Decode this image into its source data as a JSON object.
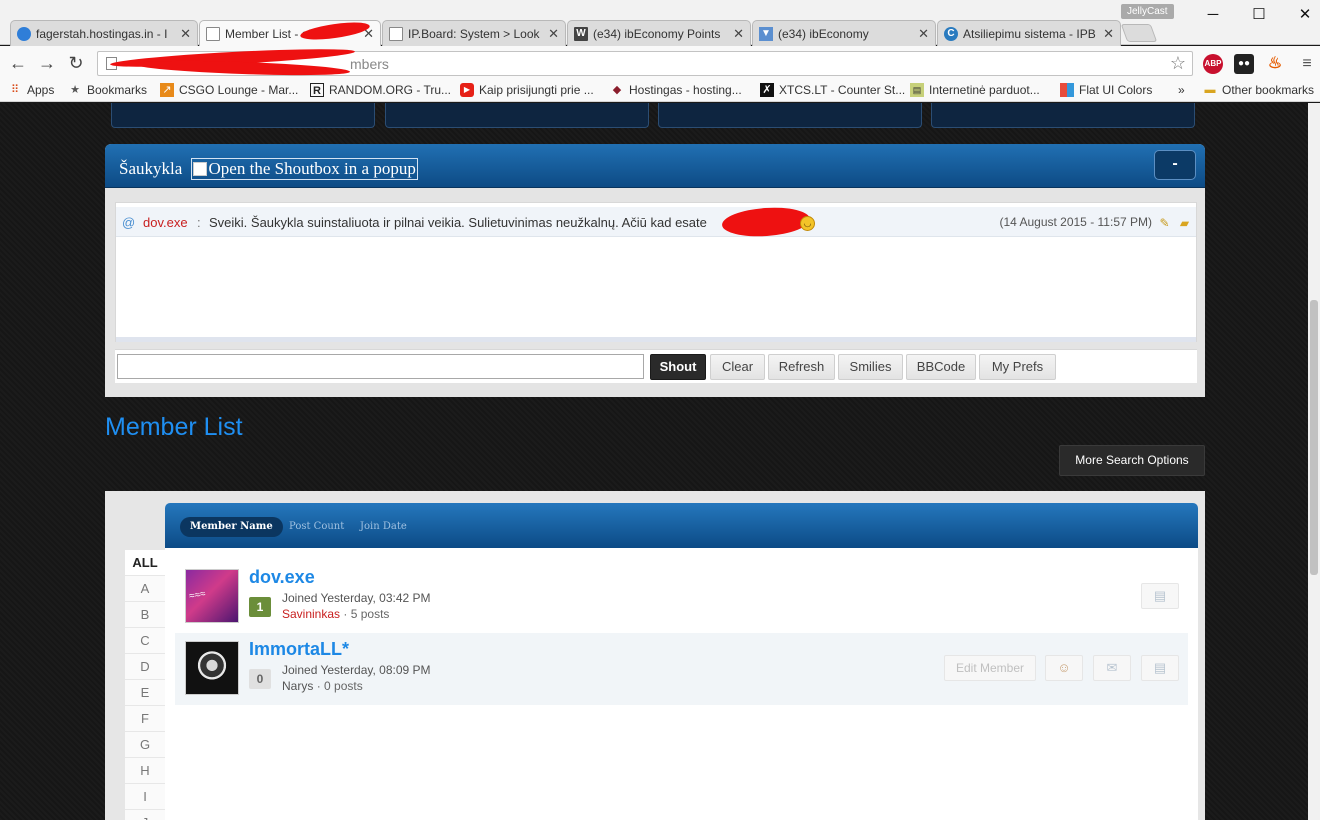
{
  "browser": {
    "profile_label": "JellyCast",
    "tabs": [
      {
        "title": "fagerstah.hostingas.in - I",
        "favicon": "globe-icon",
        "color": "#2f7ed8"
      },
      {
        "title": "Member List - eP",
        "favicon": "page-icon",
        "color": "#ffffff"
      },
      {
        "title": "IP.Board: System > Look",
        "favicon": "page-icon",
        "color": "#ffffff"
      },
      {
        "title": "(e34) ibEconomy Points",
        "favicon": "w-icon",
        "color": "#444444"
      },
      {
        "title": "(e34) ibEconomy",
        "favicon": "v-icon",
        "color": "#5b8fd0"
      },
      {
        "title": "Atsiliepimu sistema - IPB",
        "favicon": "c-icon",
        "color": "#2a7bbf"
      }
    ],
    "address_visible": "mbers",
    "bookmarks": [
      {
        "label": "Apps",
        "icon": "apps-icon"
      },
      {
        "label": "Bookmarks",
        "icon": "star-icon"
      },
      {
        "label": "CSGO Lounge - Mar...",
        "icon": "csgo-icon"
      },
      {
        "label": "RANDOM.ORG - Tru...",
        "icon": "random-icon"
      },
      {
        "label": "Kaip prisijungti prie ...",
        "icon": "youtube-icon"
      },
      {
        "label": "Hostingas - hosting...",
        "icon": "hostingas-icon"
      },
      {
        "label": "XTCS.LT - Counter St...",
        "icon": "xtcs-icon"
      },
      {
        "label": "Internetinė parduot...",
        "icon": "shop-icon"
      },
      {
        "label": "Flat UI Colors",
        "icon": "flatui-icon"
      }
    ],
    "bookmarks_overflow": "»",
    "other_bookmarks": "Other bookmarks",
    "extensions": [
      "ABP",
      "ghost",
      "fire"
    ]
  },
  "shoutbox": {
    "title": "Šaukykla",
    "popup_label": "Open the Shoutbox in a popup",
    "toggle_label": "-",
    "messages": [
      {
        "user": "dov.exe",
        "separator": ":",
        "text": "Sveiki. Šaukykla suinstaliuota ir pilnai veikia. Sulietuvinimas neužkalnų. Ačiū kad esate",
        "time": "(14 August 2015 - 11:57 PM)"
      }
    ],
    "buttons": {
      "shout": "Shout",
      "clear": "Clear",
      "refresh": "Refresh",
      "smilies": "Smilies",
      "bbcode": "BBCode",
      "prefs": "My Prefs"
    }
  },
  "member_list": {
    "title": "Member List",
    "more_search": "More Search Options",
    "sort_tabs": [
      "Member Name",
      "Post Count",
      "Join Date"
    ],
    "letters": [
      "ALL",
      "A",
      "B",
      "C",
      "D",
      "E",
      "F",
      "G",
      "H",
      "I",
      "J"
    ],
    "members": [
      {
        "name": "dov.exe",
        "reputation": "1",
        "rep_color": "#6b8e3a",
        "joined": "Joined Yesterday, 03:42 PM",
        "group": "Savininkas",
        "group_color": "#c81f1f",
        "posts": "5 posts"
      },
      {
        "name": "ImmortaLL*",
        "reputation": "0",
        "rep_color": "#e0e0e0",
        "joined": "Joined Yesterday, 08:09 PM",
        "group": "Narys",
        "group_color": "#555555",
        "posts": "0 posts",
        "edit_label": "Edit Member"
      }
    ]
  }
}
